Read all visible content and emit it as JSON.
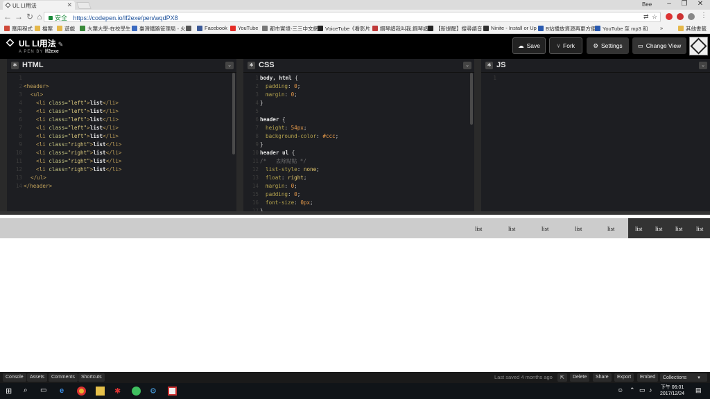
{
  "browser": {
    "tab_title": "UL LI用法",
    "window_user": "Bee",
    "secure_label": "安全",
    "url": "https://codepen.io/lf2exe/pen/wqdPX8",
    "bookmarks": [
      {
        "label": "應用程式",
        "color": "#d04a3a"
      },
      {
        "label": "檔案",
        "color": "#e5b84a"
      },
      {
        "label": "遊戲",
        "color": "#e5b84a"
      },
      {
        "label": "大葉大學-在校學生",
        "color": "#3a8a3a"
      },
      {
        "label": "臺灣鐵路管理局 - 火車",
        "color": "#3a6ac0"
      },
      {
        "label": "",
        "color": "#555555"
      },
      {
        "label": "Facebook",
        "color": "#3b5998"
      },
      {
        "label": "YouTube",
        "color": "#e52d27"
      },
      {
        "label": "都市實境-三三中文網",
        "color": "#777777"
      },
      {
        "label": "VoiceTube《看影片",
        "color": "#222222"
      },
      {
        "label": "鋼琴譜我叫我,鋼琴譜",
        "color": "#c03a3a"
      },
      {
        "label": "【新提醒】搜尋語音",
        "color": "#222222"
      },
      {
        "label": "Ninite - Install or Up",
        "color": "#333333"
      },
      {
        "label": "B站播放資源再更方便",
        "color": "#2a5ab0"
      },
      {
        "label": "YouTube 至 mp3 和",
        "color": "#2a5ab0"
      },
      {
        "label": "»",
        "color": ""
      },
      {
        "label": "其他書籤",
        "color": "#e5b84a"
      }
    ]
  },
  "header": {
    "title": "UL LI用法",
    "by_prefix": "A PEN BY",
    "author": "lf2exe",
    "save_label": "Save",
    "fork_label": "Fork",
    "settings_label": "Settings",
    "change_view_label": "Change View"
  },
  "panes": {
    "html": {
      "label": "HTML"
    },
    "css": {
      "label": "CSS"
    },
    "js": {
      "label": "JS"
    }
  },
  "preview": {
    "left_items": [
      "list",
      "list",
      "list",
      "list",
      "list"
    ],
    "right_items": [
      "list",
      "list",
      "list",
      "list"
    ]
  },
  "footer": {
    "console_label": "Console",
    "assets_label": "Assets",
    "comments_label": "Comments",
    "shortcuts_label": "Shortcuts",
    "saved_text": "Last saved 4 months ago",
    "delete_label": "Delete",
    "share_label": "Share",
    "export_label": "Export",
    "embed_label": "Embed",
    "collections_label": "Collections"
  },
  "taskbar": {
    "time": "下午 06:01",
    "date": "2017/12/24"
  }
}
